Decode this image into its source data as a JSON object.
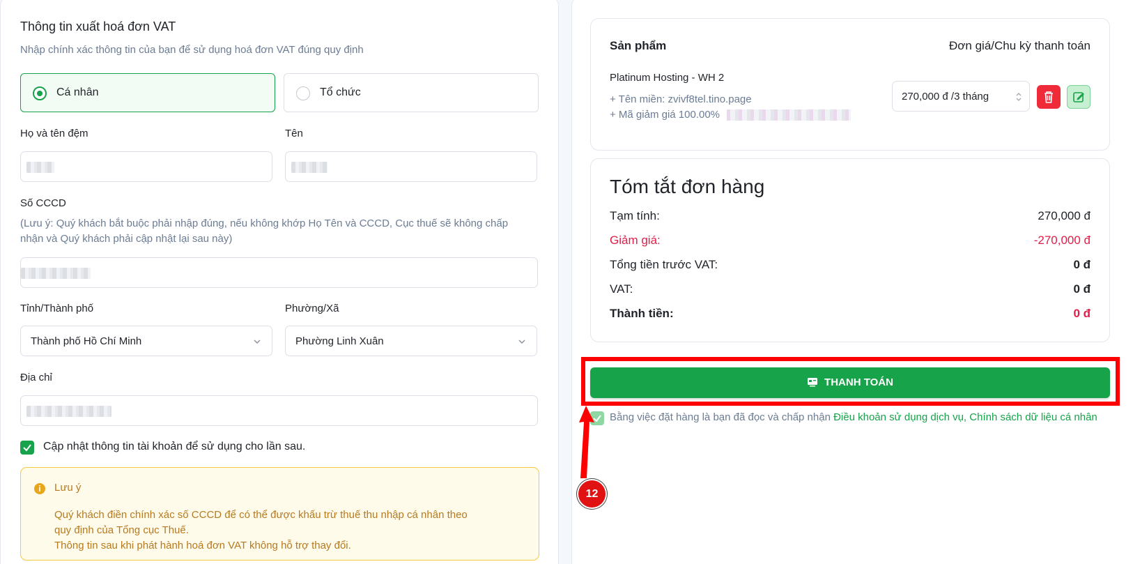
{
  "vat_form": {
    "title": "Thông tin xuất hoá đơn VAT",
    "subtitle": "Nhập chính xác thông tin của bạn để sử dụng hoá đơn VAT đúng quy định",
    "type_options": [
      {
        "label": "Cá nhân",
        "selected": true
      },
      {
        "label": "Tổ chức",
        "selected": false
      }
    ],
    "middle_name_label": "Họ và tên đệm",
    "first_name_label": "Tên",
    "id_label": "Số CCCD",
    "id_note": "(Lưu ý: Quý khách bắt buộc phải nhập đúng, nếu không khớp Họ Tên và CCCD, Cục thuế sẽ không chấp nhận và Quý khách phải cập nhật lại sau này)",
    "province_label": "Tỉnh/Thành phố",
    "province_value": "Thành phố Hồ Chí Minh",
    "ward_label": "Phường/Xã",
    "ward_value": "Phường Linh Xuân",
    "address_label": "Địa chỉ",
    "update_checkbox_label": "Cập nhật thông tin tài khoản để sử dụng cho lần sau.",
    "notice": {
      "title": "Lưu ý",
      "line1": "Quý khách điền chính xác số CCCD để có thể được khấu trừ thuế thu nhập cá nhân theo",
      "line2": "quy định của Tổng cục Thuế.",
      "line3": "Thông tin sau khi phát hành hoá đơn VAT không hỗ trợ thay đổi."
    }
  },
  "cart": {
    "product_header": "Sản phẩm",
    "price_header": "Đơn giá/Chu kỳ thanh toán",
    "item": {
      "name": "Platinum Hosting - WH 2",
      "domain": "+ Tên miền: zvivf8tel.tino.page",
      "coupon": "+ Mã giảm giá 100.00%",
      "cycle": "270,000 đ /3 tháng"
    }
  },
  "summary": {
    "title": "Tóm tắt đơn hàng",
    "subtotal_label": "Tạm tính:",
    "subtotal_value": "270,000 đ",
    "discount_label": "Giảm giá:",
    "discount_value": "-270,000 đ",
    "pre_vat_label": "Tổng tiền trước VAT:",
    "pre_vat_value": "0 đ",
    "vat_label": "VAT:",
    "vat_value": "0 đ",
    "total_label": "Thành tiền:",
    "total_value": "0 đ"
  },
  "pay_button": "THANH TOÁN",
  "terms": {
    "text": "Bằng việc đặt hàng là bạn đã đọc và chấp nhận",
    "link1": "Điều khoản sử dụng dịch vụ",
    "sep": ",",
    "link2": "Chính sách dữ liệu cá nhân"
  },
  "annotation": {
    "step": "12"
  },
  "colors": {
    "accent_green": "#16a34a",
    "danger_red": "#e11d48",
    "highlight_red": "#ff0000"
  }
}
